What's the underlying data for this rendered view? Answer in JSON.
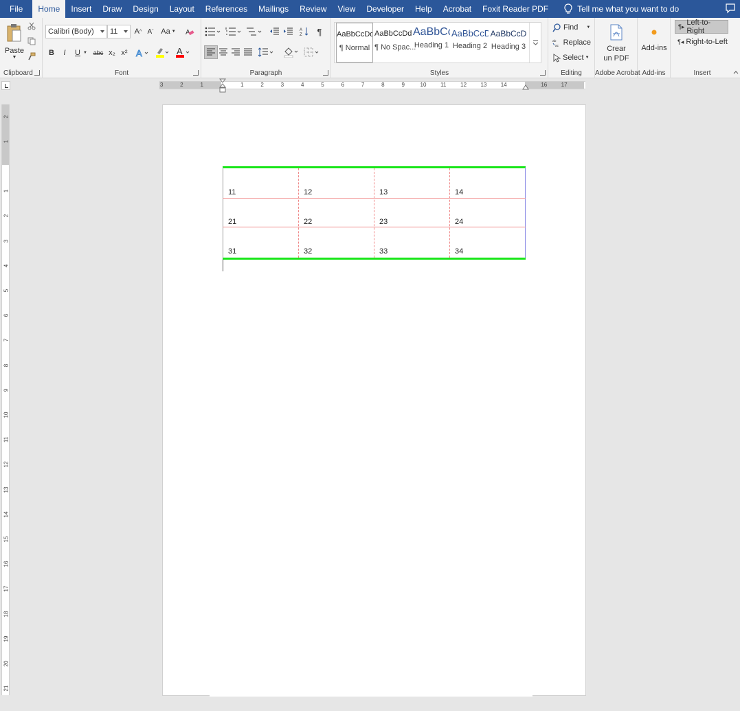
{
  "menu": {
    "tabs": [
      "File",
      "Home",
      "Insert",
      "Draw",
      "Design",
      "Layout",
      "References",
      "Mailings",
      "Review",
      "View",
      "Developer",
      "Help",
      "Acrobat",
      "Foxit Reader PDF"
    ],
    "active_tab": "Home",
    "tell_me": "Tell me what you want to do"
  },
  "clipboard": {
    "paste": "Paste",
    "label": "Clipboard"
  },
  "font": {
    "family": "Calibri (Body)",
    "size": "11",
    "change_case": "Aa",
    "bold": "B",
    "italic": "I",
    "underline": "U",
    "strike": "abc",
    "sub": "x₂",
    "sup": "x²",
    "label": "Font",
    "colors": {
      "highlight": "#ffff00",
      "font_color": "#ff0000"
    }
  },
  "paragraph": {
    "label": "Paragraph",
    "show_marks": "¶"
  },
  "styles": {
    "label": "Styles",
    "items": [
      {
        "preview": "AaBbCcDd",
        "name": "¶ Normal"
      },
      {
        "preview": "AaBbCcDd",
        "name": "¶ No Spac..."
      },
      {
        "preview": "AaBbCc",
        "name": "Heading 1"
      },
      {
        "preview": "AaBbCcD",
        "name": "Heading 2"
      },
      {
        "preview": "AaBbCcD",
        "name": "Heading 3"
      }
    ]
  },
  "editing": {
    "find": "Find",
    "replace": "Replace",
    "select": "Select",
    "label": "Editing"
  },
  "acrobat": {
    "line1": "Crear",
    "line2": "un PDF",
    "label": "Adobe Acrobat"
  },
  "addins": {
    "button": "Add-ins",
    "label": "Add-ins"
  },
  "insert": {
    "ltr": "Left-to-Right",
    "rtl": "Right-to-Left",
    "label": "Insert"
  },
  "ruler": {
    "h_numbers": [
      "3",
      "2",
      "1",
      "1",
      "2",
      "3",
      "4",
      "5",
      "6",
      "7",
      "8",
      "9",
      "10",
      "11",
      "12",
      "13",
      "14",
      "16",
      "17"
    ],
    "v_numbers": [
      "2",
      "1",
      "1",
      "2",
      "3",
      "4",
      "5",
      "6",
      "7",
      "8",
      "9",
      "10",
      "11",
      "12",
      "13",
      "14",
      "15",
      "16",
      "17",
      "18",
      "19",
      "20",
      "21"
    ]
  },
  "table": {
    "rows": [
      [
        "11",
        "12",
        "13",
        "14"
      ],
      [
        "21",
        "22",
        "23",
        "24"
      ],
      [
        "31",
        "32",
        "33",
        "34"
      ]
    ],
    "colors": {
      "top_bottom_border": "#19e619",
      "inner_border": "#f08a8a",
      "right_border": "#8a8ae6"
    }
  },
  "theme": {
    "accent": "#2b579a"
  }
}
